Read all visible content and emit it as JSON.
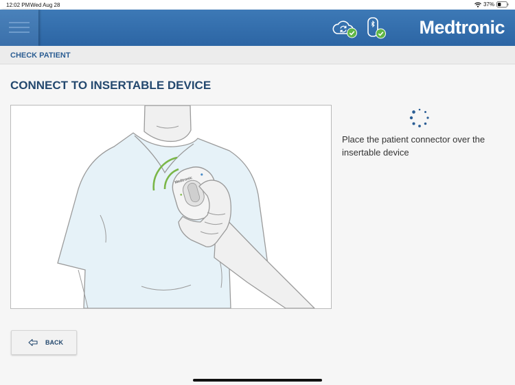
{
  "status_bar": {
    "time": "12:02 PM",
    "date": "Wed Aug 28",
    "battery": "37%",
    "battery_level": 0.37,
    "icons": [
      "wifi-icon",
      "battery-icon"
    ]
  },
  "header": {
    "brand": "Medtronic",
    "icons": [
      "menu-icon",
      "cloud-sync-icon",
      "patient-connector-icon",
      "check-icon"
    ],
    "colors": {
      "header": "#2f69a8",
      "check_badge": "#5fb646"
    }
  },
  "breadcrumb": {
    "label": "CHECK PATIENT"
  },
  "main": {
    "title": "CONNECT TO INSERTABLE DEVICE",
    "illustration_device_brand": "Medtronic",
    "instruction": "Place the patient connector over the insertable device",
    "colors": {
      "title": "#23486e",
      "scrubs": "#e6f2f8",
      "signal": "#7ab648"
    }
  },
  "footer": {
    "back_label": "BACK",
    "icons": [
      "back-arrow-icon",
      "loading-spinner-icon"
    ]
  }
}
